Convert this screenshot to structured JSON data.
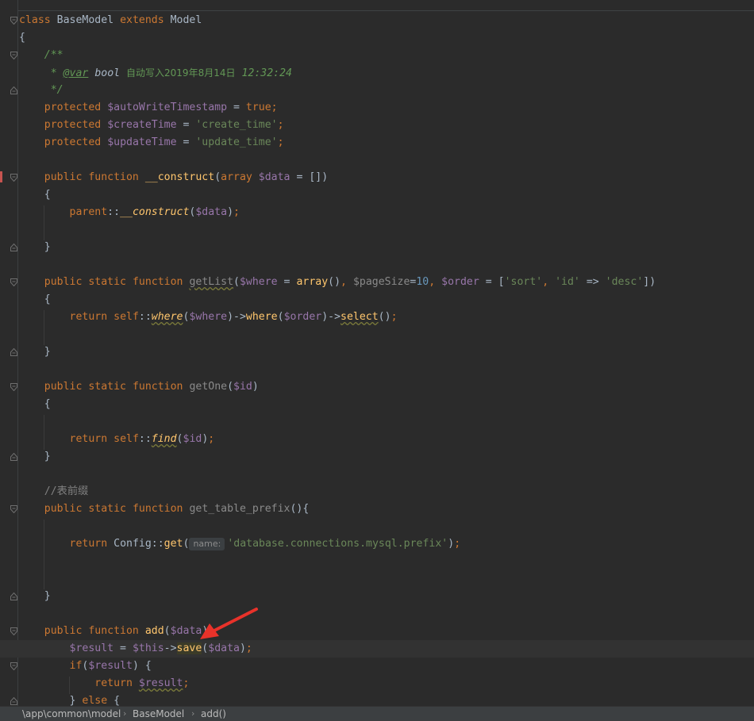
{
  "code": {
    "class_kw": "class",
    "class_name": "BaseModel",
    "extends_kw": "extends",
    "parent_class": "Model",
    "open_brace": "{",
    "close_brace": "}",
    "doc_open": "/**",
    "doc_star": " * ",
    "doc_tag": "@var",
    "doc_type": "bool",
    "doc_text": "自动写入2019年8月14日",
    "doc_time": "12:32:24",
    "doc_close": " */",
    "protected_kw": "protected",
    "public_kw": "public",
    "static_kw": "static",
    "function_kw": "function",
    "return_kw": "return",
    "if_kw": "if",
    "else_kw": "else",
    "array_kw": "array",
    "prop_auto": "$autoWriteTimestamp",
    "prop_auto_val": "true",
    "prop_create": "$createTime",
    "prop_create_val": "'create_time'",
    "prop_update": "$updateTime",
    "prop_update_val": "'update_time'",
    "ctor_name": "__construct",
    "param_data": "$data",
    "empty_array": "[]",
    "parent_kw": "parent",
    "getlist_name": "getList",
    "param_where": "$where",
    "param_pagesize": "$pageSize",
    "pagesize_default": "10",
    "param_order": "$order",
    "str_sort": "'sort'",
    "str_id": "'id'",
    "str_desc": "'desc'",
    "self_kw": "self",
    "where_fn": "where",
    "select_fn": "select",
    "getone_name": "getOne",
    "param_id": "$id",
    "find_fn": "find",
    "comment_prefix": "//表前缀",
    "prefix_fn_name": "get_table_prefix",
    "config_class": "Config",
    "get_fn": "get",
    "hint_name": "name:",
    "config_key": "'database.connections.mysql.prefix'",
    "add_name": "add",
    "var_result": "$result",
    "this_kw": "$this",
    "save_fn": "save"
  },
  "breadcrumb": [
    "\\app\\common\\model",
    "BaseModel",
    "add()"
  ],
  "colors": {
    "background": "#2b2b2b",
    "keyword": "#cc7832",
    "string": "#6a8759",
    "variable": "#9876aa",
    "function": "#ffc66d",
    "annotation_arrow": "#e8322a"
  }
}
